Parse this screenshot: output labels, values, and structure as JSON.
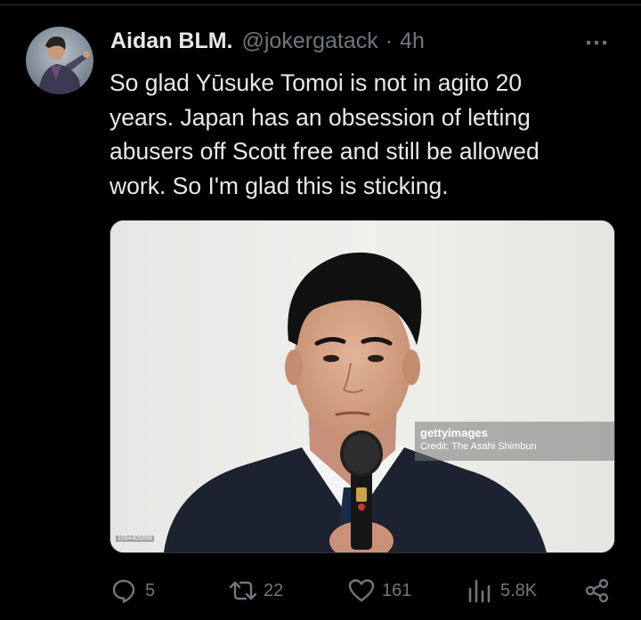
{
  "tweet": {
    "author": {
      "display_name": "Aidan BLM.",
      "handle": "@jokergatack",
      "separator": "·",
      "time": "4h"
    },
    "text_lines": [
      "So glad Yūsuke Tomoi is not in agito 20",
      "years. Japan has an obsession of letting",
      "abusers off Scott free and still be allowed",
      "work. So I'm glad this is sticking."
    ],
    "media": {
      "watermark_brand": "gettyimages",
      "watermark_credit": "Credit: The Asahi Shimbun",
      "photo_id": "1094405898"
    }
  },
  "actions": {
    "replies": "5",
    "retweets": "22",
    "likes": "161",
    "views": "5.8K"
  },
  "icons": {
    "more": "more-horizontal-icon",
    "reply": "reply-icon",
    "retweet": "retweet-icon",
    "like": "heart-icon",
    "views": "views-icon",
    "share": "share-icon"
  },
  "colors": {
    "background": "#000000",
    "text": "#e7e9ea",
    "muted": "#71767b",
    "divider": "#2f3336"
  }
}
